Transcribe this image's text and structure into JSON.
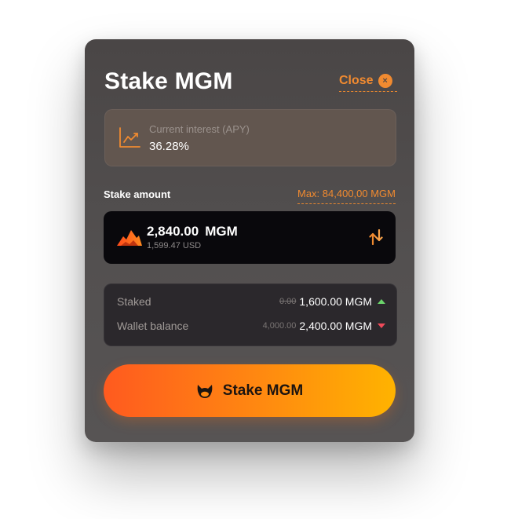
{
  "modal": {
    "title": "Stake MGM",
    "close_label": "Close",
    "close_icon": "×"
  },
  "apy": {
    "label": "Current interest (APY)",
    "value": "36.28%",
    "icon": "chart-trend-icon"
  },
  "stake": {
    "label": "Stake amount",
    "max_label": "Max: 84,400,00 MGM",
    "amount": "2,840.00",
    "unit": "MGM",
    "usd": "1,599.47 USD"
  },
  "summary": {
    "rows": [
      {
        "label": "Staked",
        "old": "0.00",
        "new": "1,600.00 MGM",
        "trend": "up"
      },
      {
        "label": "Wallet balance",
        "old": "4,000.00",
        "new": "2,400.00 MGM",
        "trend": "down"
      }
    ]
  },
  "button": {
    "label": "Stake MGM"
  },
  "colors": {
    "accent": "#f08a30",
    "up": "#6bd46b",
    "down": "#ef4a5a",
    "button_start": "#ff5a1f",
    "button_end": "#ffb300"
  }
}
